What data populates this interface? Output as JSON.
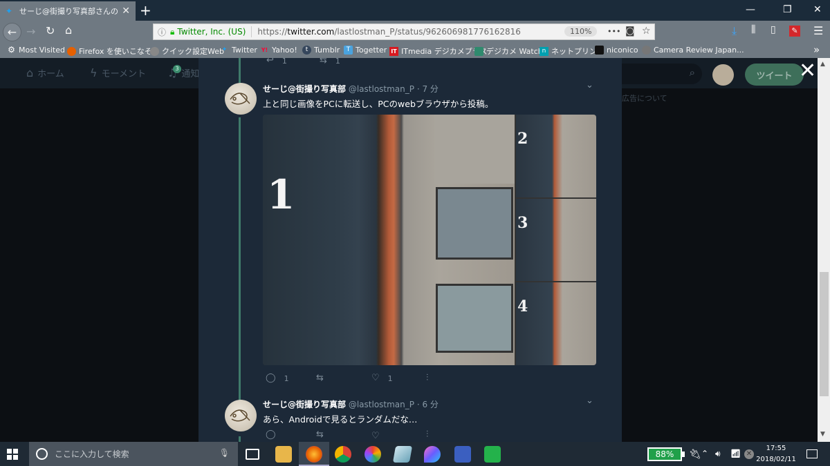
{
  "browser": {
    "tab_title": "せーじ@街撮り写真部さんのツイート",
    "new_tab": "+",
    "window_controls": {
      "minimize": "—",
      "restore": "❐",
      "close": "✕"
    },
    "nav": {
      "back": "←",
      "forward": "→",
      "reload": "↻",
      "home": "⌂"
    },
    "url": {
      "info_icon": "ⓘ",
      "identity": "Twitter, Inc. (US)",
      "scheme": "https://",
      "domain": "twitter.com",
      "path": "/lastlostman_P/status/962606981776162816",
      "zoom": "110%",
      "more": "•••",
      "pocket": "◙",
      "star": "☆"
    },
    "toolbar_icons": {
      "download": "⤓",
      "library": "⫼",
      "sidebar": "▯",
      "addon": "✎",
      "menu": "☰"
    },
    "bookmarks": [
      {
        "label": "Most Visited",
        "icon": "⚙",
        "color": "#6f7982"
      },
      {
        "label": "Firefox を使いこなそう",
        "icon": "●",
        "color": "#e66000"
      },
      {
        "label": "クイック設定Web",
        "icon": "◎",
        "color": "#888888"
      },
      {
        "label": "Twitter",
        "icon": "✦",
        "color": "#1da1f2"
      },
      {
        "label": "Yahoo!",
        "icon": "Y!",
        "color": "#ff0033"
      },
      {
        "label": "Tumblr",
        "icon": "t",
        "color": "#35465c"
      },
      {
        "label": "Togetter",
        "icon": "T",
        "color": "#4aa3df"
      },
      {
        "label": "ITmedia デジカメプラス",
        "icon": "IT",
        "color": "#d71920"
      },
      {
        "label": "デジカメ Watch",
        "icon": "▤",
        "color": "#2f8a6e"
      },
      {
        "label": "ネットプリント",
        "icon": "n",
        "color": "#00a0b0"
      },
      {
        "label": "niconico",
        "icon": "▣",
        "color": "#111111"
      },
      {
        "label": "Camera Review Japan...",
        "icon": "◍",
        "color": "#777777"
      }
    ],
    "bookmarks_overflow": "»"
  },
  "twitter": {
    "nav": [
      {
        "label": "ホーム",
        "icon": "⌂"
      },
      {
        "label": "モーメント",
        "icon": "ϟ"
      },
      {
        "label": "通知",
        "icon": "♫"
      }
    ],
    "notif_count": "3",
    "search_icon": "⌕",
    "tweet_button": "ツイート",
    "close_overlay": "✕",
    "ads_text": "広告について",
    "prev_actions": {
      "reply": "1",
      "retweet": "1"
    },
    "tweets": [
      {
        "name": "せーじ@街撮り写真部",
        "handle": "@lastlostman_P",
        "time": "· 7 分",
        "text": "上と同じ画像をPCに転送し、PCのwebブラウザから投稿。",
        "photo_labels": [
          "1",
          "2",
          "3",
          "4"
        ],
        "replies": "1",
        "retweets": "",
        "likes": "1"
      },
      {
        "name": "せーじ@街撮り写真部",
        "handle": "@lastlostman_P",
        "time": "· 6 分",
        "text": "あら、Androidで見るとランダムだな…",
        "replies": "",
        "retweets": "",
        "likes": ""
      }
    ],
    "action_icons": {
      "reply": "◯",
      "retweet": "⇆",
      "like": "♡",
      "analytics": "⫶",
      "caret": "⌄"
    }
  },
  "taskbar": {
    "search_placeholder": "ここに入力して検索",
    "battery": "88%",
    "time": "17:55",
    "date": "2018/02/11",
    "apps": [
      "task-view",
      "file-explorer",
      "firefox",
      "chrome",
      "picasa",
      "notepad",
      "paint",
      "app-2",
      "line"
    ]
  }
}
